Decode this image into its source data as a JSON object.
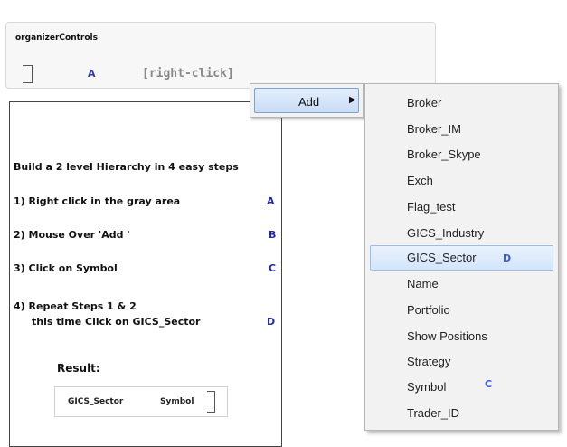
{
  "organizer": {
    "title": "organizerControls",
    "letter": "A",
    "hint": "[right-click]"
  },
  "instructions": {
    "heading": "Build a 2 level Hierarchy in 4 easy steps",
    "steps": [
      {
        "text": "1) Right click in the gray area",
        "letter": "A"
      },
      {
        "text": "2) Mouse Over  'Add '",
        "letter": "B"
      },
      {
        "text": "3) Click on Symbol",
        "letter": "C"
      },
      {
        "text": "4) Repeat Steps 1 & 2",
        "line2": "this time Click on GICS_Sector",
        "letter": "D"
      }
    ],
    "result_label": "Result:",
    "result_items": [
      "GICS_Sector",
      "Symbol"
    ]
  },
  "context_menu": {
    "add_label": "Add",
    "arrow": "▶"
  },
  "submenu": {
    "items": [
      "Broker",
      "Broker_IM",
      "Broker_Skype",
      "Exch",
      "Flag_test",
      "GICS_Industry",
      "GICS_Sector",
      "Name",
      "Portfolio",
      "Show Positions",
      "Strategy",
      "Symbol",
      "Trader_ID"
    ],
    "highlighted_marker": "D",
    "symbol_marker": "C"
  }
}
